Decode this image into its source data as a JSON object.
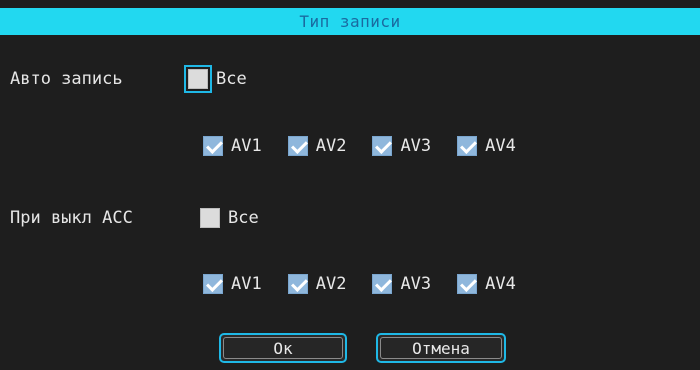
{
  "dialog": {
    "title": "Тип записи",
    "auto_record": {
      "label": "Авто запись",
      "all_label": "Все",
      "all_checked": false,
      "channels": [
        {
          "label": "AV1",
          "checked": true
        },
        {
          "label": "AV2",
          "checked": true
        },
        {
          "label": "AV3",
          "checked": true
        },
        {
          "label": "AV4",
          "checked": true
        }
      ]
    },
    "acc_off": {
      "label": "При выкл АСС",
      "all_label": "Все",
      "all_checked": false,
      "channels": [
        {
          "label": "AV1",
          "checked": true
        },
        {
          "label": "AV2",
          "checked": true
        },
        {
          "label": "AV3",
          "checked": true
        },
        {
          "label": "AV4",
          "checked": true
        }
      ]
    },
    "ok_label": "Ок",
    "cancel_label": "Отмена"
  },
  "colors": {
    "title_bar": "#22d8f0",
    "title_text": "#1a6aa0",
    "focus_border": "#1fb8e6",
    "background": "#1e1e1e"
  }
}
